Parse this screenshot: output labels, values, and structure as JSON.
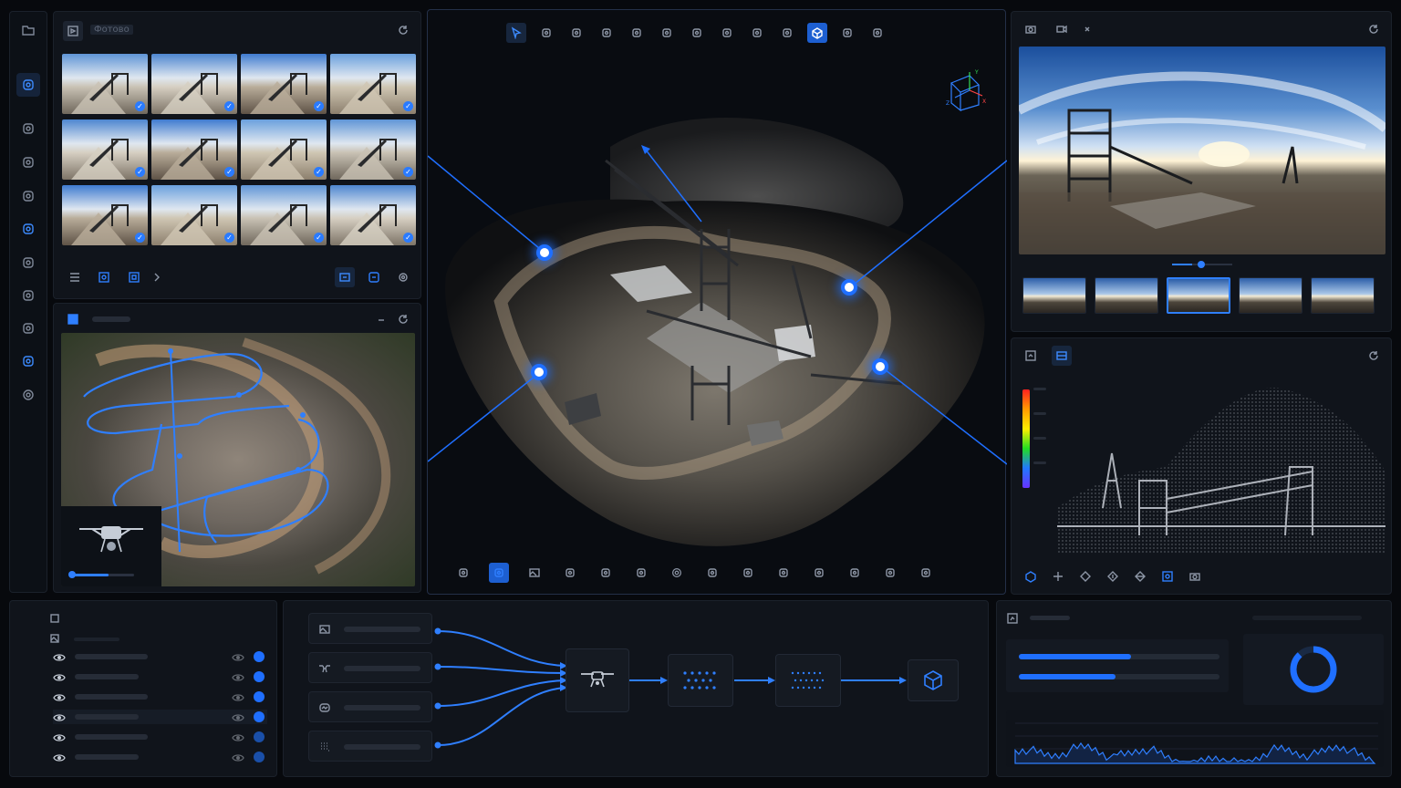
{
  "app": {
    "accent": "#1f6fff",
    "background": "#07090d",
    "panel": "#10141b"
  },
  "sidebar": {
    "items": [
      {
        "icon": "folder-icon"
      },
      {
        "icon": "chart-check-icon",
        "active": true
      },
      {
        "icon": "cube-outline-icon"
      },
      {
        "icon": "cube-solid-icon"
      },
      {
        "icon": "mountain-icon"
      },
      {
        "icon": "layers-icon",
        "active": true
      },
      {
        "icon": "terrain-icon"
      },
      {
        "icon": "dollar-circle-icon"
      },
      {
        "icon": "map-pin-icon"
      },
      {
        "icon": "scan-cube-icon",
        "active": true
      },
      {
        "icon": "settings-icon"
      }
    ]
  },
  "photos_panel": {
    "title": "Фотово",
    "photos": [
      {
        "checked": true
      },
      {
        "checked": true
      },
      {
        "checked": true
      },
      {
        "checked": true
      },
      {
        "checked": true
      },
      {
        "checked": true
      },
      {
        "checked": true
      },
      {
        "checked": true
      },
      {
        "checked": true
      },
      {
        "checked": true
      },
      {
        "checked": true
      },
      {
        "checked": true
      }
    ]
  },
  "flight_panel": {
    "progress": 0.6
  },
  "viewport": {
    "toolbar_top": [
      "cursor-icon",
      "rotate-icon",
      "measure-icon",
      "expand-icon",
      "target-icon",
      "camera-icon",
      "crop-icon",
      "scale-icon",
      "video-icon",
      "grid-icon",
      "cube-icon",
      "scan-icon",
      "record-icon"
    ],
    "toolbar_bottom": [
      "frame-icon",
      "square-icon",
      "image-icon",
      "hexagon-icon",
      "box-icon",
      "sphere-icon",
      "settings-icon",
      "camera-icon",
      "grid-icon",
      "table-icon",
      "upload-icon",
      "layers-icon",
      "scan-icon",
      "expand-icon"
    ],
    "axis_labels": {
      "y": "Y",
      "x": "X",
      "z": "Z"
    }
  },
  "panorama_panel": {
    "selected_thumb": 2,
    "thumb_count": 5,
    "slider": 0.33
  },
  "pointcloud_panel": {
    "legend_colors": [
      "#ff2020",
      "#ff9900",
      "#ffee00",
      "#22dd22",
      "#2277ff",
      "#6633ff"
    ]
  },
  "layers_panel": {
    "rows": [
      {
        "visible": true,
        "dot": "#1f6fff"
      },
      {
        "visible": true,
        "dot": "#1f6fff"
      },
      {
        "visible": true,
        "dot": "#1f6fff"
      },
      {
        "visible": true,
        "dot": "#1f6fff"
      },
      {
        "visible": true,
        "dot": "#1a4fa8"
      },
      {
        "visible": true,
        "dot": "#1a4fa8"
      }
    ]
  },
  "pipeline": {
    "sources": [
      "image-icon",
      "drone-icon",
      "signal-icon",
      "pointcloud-icon"
    ],
    "nodes": [
      "drone-icon",
      "grid-dots-icon",
      "grid-dots-icon",
      "cube-icon"
    ]
  },
  "stats_panel": {
    "bar1": 0.56,
    "bar2": 0.48,
    "donut": 0.88
  }
}
